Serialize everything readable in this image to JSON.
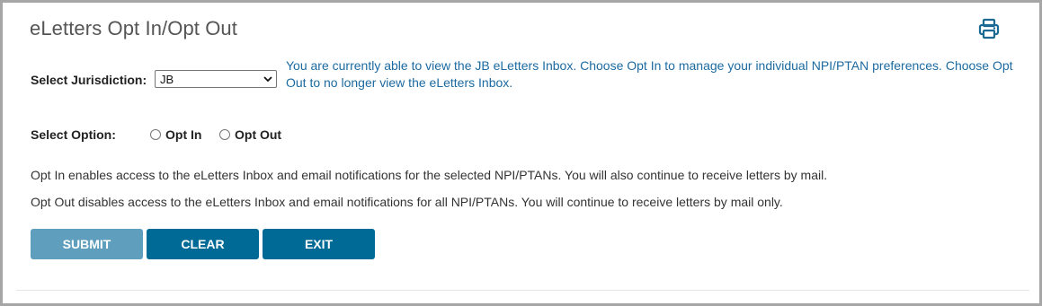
{
  "page": {
    "title": "eLetters Opt In/Opt Out"
  },
  "jurisdiction": {
    "label": "Select Jurisdiction:",
    "selected": "JB",
    "info": "You are currently able to view the JB eLetters Inbox. Choose Opt In to manage your individual NPI/PTAN preferences. Choose Opt Out to no longer view the eLetters Inbox."
  },
  "option": {
    "label": "Select Option:",
    "opt_in": "Opt In",
    "opt_out": "Opt Out"
  },
  "descriptions": {
    "opt_in": "Opt In enables access to the eLetters Inbox and email notifications for the selected NPI/PTANs. You will also continue to receive letters by mail.",
    "opt_out": "Opt Out disables access to the eLetters Inbox and email notifications for all NPI/PTANs. You will continue to receive letters by mail only."
  },
  "buttons": {
    "submit": "SUBMIT",
    "clear": "CLEAR",
    "exit": "EXIT"
  },
  "icons": {
    "print": "print-icon",
    "dropdown": "chevron-down-icon"
  },
  "colors": {
    "primary": "#006a96",
    "primary_disabled": "#5f9fbd",
    "info_text": "#1c6aa0"
  }
}
